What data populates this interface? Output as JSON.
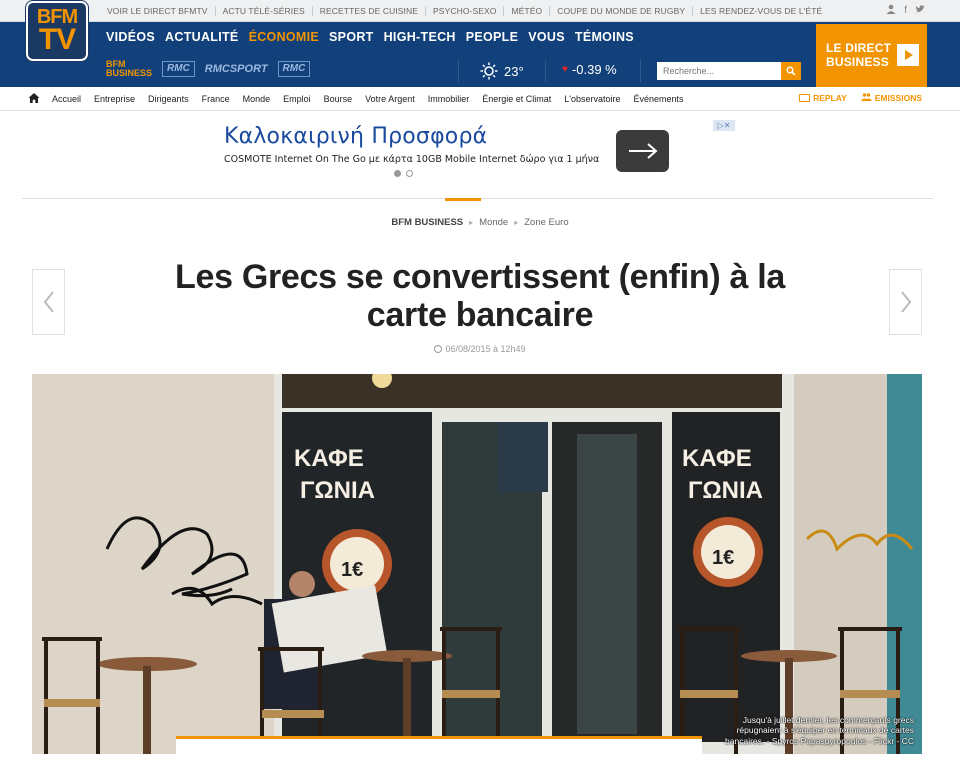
{
  "topbar": {
    "links": [
      "VOIR LE DIRECT BFMTV",
      "ACTU TÉLÉ-SÉRIES",
      "RECETTES DE CUISINE",
      "PSYCHO-SEXO",
      "MÉTÉO",
      "COUPE DU MONDE DE RUGBY",
      "LES RENDEZ-VOUS DE L'ÉTÉ"
    ],
    "social": [
      "user-icon",
      "facebook-icon",
      "twitter-icon"
    ]
  },
  "logo": {
    "line1": "BFM",
    "line2": "TV"
  },
  "mainnav": {
    "items": [
      {
        "label": "VIDÉOS",
        "active": false
      },
      {
        "label": "ACTUALITÉ",
        "active": false
      },
      {
        "label": "ÉCONOMIE",
        "active": true
      },
      {
        "label": "SPORT",
        "active": false
      },
      {
        "label": "HIGH-TECH",
        "active": false
      },
      {
        "label": "PEOPLE",
        "active": false
      },
      {
        "label": "VOUS",
        "active": false
      },
      {
        "label": "TÉMOINS",
        "active": false
      }
    ]
  },
  "brands": [
    "BFM",
    "BUSINESS",
    "RMC",
    "RMCSPORT",
    "RMC"
  ],
  "weather": {
    "temp": "23°",
    "icon": "sun-icon"
  },
  "market": {
    "change": "-0.39 %",
    "icon": "heart-icon"
  },
  "search": {
    "placeholder": "Recherche..."
  },
  "direct": {
    "line1": "LE DIRECT",
    "line2": "BUSINESS"
  },
  "secnav": {
    "items": [
      "Accueil",
      "Entreprise",
      "Dirigeants",
      "France",
      "Monde",
      "Emploi",
      "Bourse",
      "Votre Argent",
      "Immobilier",
      "Énergie et Climat",
      "L'observatoire",
      "Événements"
    ],
    "replay": "REPLAY",
    "emissions": "EMISSIONS"
  },
  "ad": {
    "title": "Καλοκαιρινή Προσφορά",
    "desc": "COSMOTE Internet On The Go με κάρτα 10GB Mobile Internet δώρο για 1 μήνα"
  },
  "breadcrumb": {
    "root": "BFM BUSINESS",
    "level1": "Monde",
    "level2": "Zone Euro"
  },
  "article": {
    "title": "Les Grecs se convertissent (enfin) à la carte bancaire",
    "date": "06/08/2015 à 12h49",
    "photo_caption": "Jusqu'à juillet dernier, les commerçants grecs répugnaient à s'équiper en terminaux de cartes bancaires. - Spyros Papaspyropoulos - Flickr - CC",
    "sign_text": "ΚΑΦΕ ΓΩΝΙΑ",
    "price_text": "1€"
  },
  "colors": {
    "brand_blue": "#12407a",
    "accent_orange": "#f29400"
  }
}
